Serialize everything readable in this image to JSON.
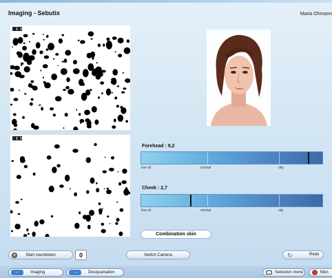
{
  "app": {
    "title": "Imaging - Sebutix",
    "user": "Maria Ohmann"
  },
  "scales": {
    "forehead": {
      "label": "Forehead : 9,2",
      "value": 9.2
    },
    "cheek": {
      "label": "Cheek : 2,7",
      "value": 2.7
    },
    "labels": {
      "low": "low oil",
      "normal": "normal",
      "oily": "oily"
    },
    "scale_max": 10
  },
  "result": {
    "skin_type": "Combination skin"
  },
  "controls": {
    "start_countdown": "Start countdown",
    "countdown_value": "0",
    "switch_camera": "Switch Camera",
    "redo": "Redo"
  },
  "nav": {
    "imaging": "Imaging",
    "desquamation": "Desquamation",
    "selection_menu": "Selection menu",
    "menu": "Men"
  },
  "colors": {
    "accent": "#3d7fd0",
    "bar_dark": "#3c6aa9",
    "bar_light": "#8ed2ee"
  }
}
